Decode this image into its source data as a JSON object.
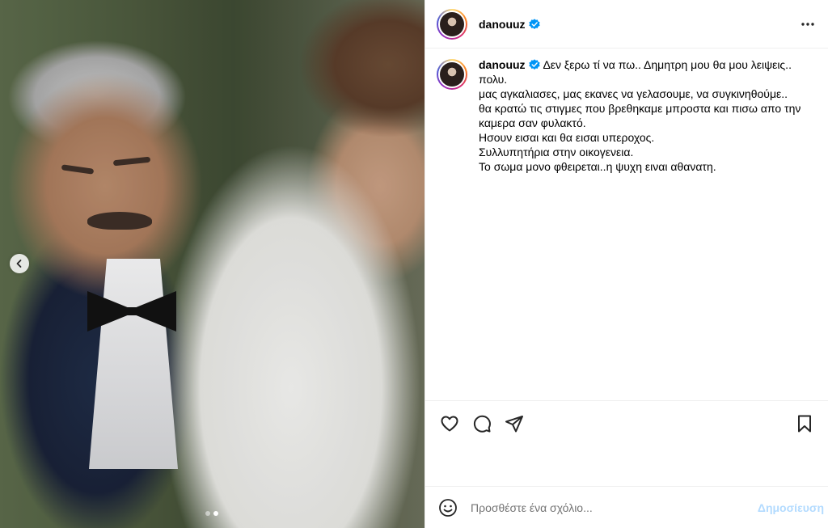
{
  "post": {
    "username": "danouuz",
    "verified": true,
    "caption_lines": [
      "Δεν ξερω τί να πω.. Δημητρη μου θα μου λειψεις.. πολυ.",
      "μας αγκαλιασες, μας εκανες να γελασουμε, να συγκινηθούμε..",
      "θα κρατώ τις στιγμες που βρεθηκαμε μπροστα και πισω απο την καμερα σαν φυλακτό.",
      "Ησουν εισαι και θα εισαι υπεροχος.",
      "Συλλυπητήρια στην οικογενεια.",
      "Το σωμα μονο φθειρεται..η ψυχη ειναι αθανατη."
    ]
  },
  "carousel": {
    "total": 2,
    "current": 2
  },
  "comment": {
    "placeholder": "Προσθέστε ένα σχόλιο...",
    "post_label": "Δημοσίευση"
  },
  "icons": {
    "prev": "chevron-left-icon",
    "more": "more-horizontal-icon",
    "verified": "verified-badge-icon",
    "like": "heart-icon",
    "comment": "comment-icon",
    "share": "send-icon",
    "save": "bookmark-icon",
    "emoji": "emoji-icon"
  },
  "colors": {
    "verified": "#0095f6",
    "post_button_disabled": "#b3dbff",
    "placeholder": "#737373"
  }
}
